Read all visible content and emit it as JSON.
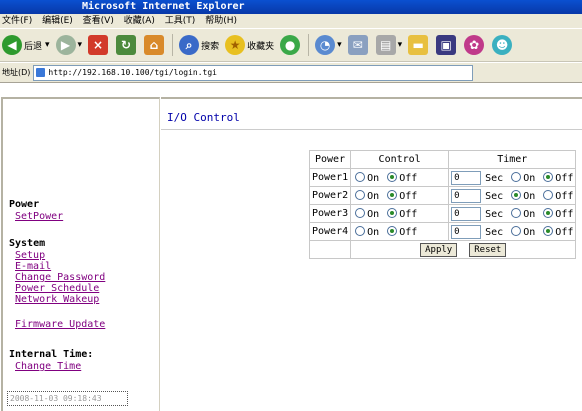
{
  "window": {
    "title": "Microsoft Internet Explorer"
  },
  "menu": [
    "文件(F)",
    "编辑(E)",
    "查看(V)",
    "收藏(A)",
    "工具(T)",
    "帮助(H)"
  ],
  "toolbar": {
    "back_label": "后退",
    "search_label": "搜索",
    "favorites_label": "收藏夹"
  },
  "address": {
    "label": "地址(D)",
    "url": "http://192.168.10.100/tgi/login.tgi"
  },
  "sidebar": {
    "power_heading": "Power",
    "set_power": "SetPower",
    "system_heading": "System",
    "setup": "Setup",
    "email": "E-mail",
    "change_password": "Change Password",
    "power_schedule": "Power Schedule",
    "network_wakeup": "Network Wakeup",
    "firmware_update": "Firmware Update",
    "internal_time_heading": "Internal Time:",
    "change_time": "Change Time",
    "current_time": "2008-11-03 09:18:43"
  },
  "main": {
    "title": "I/O Control",
    "headers": {
      "power": "Power",
      "control": "Control",
      "timer": "Timer"
    },
    "on_label": "On",
    "off_label": "Off",
    "sec_label": "Sec",
    "rows": [
      {
        "name": "Power1",
        "control": "off",
        "timer": "0",
        "timer_state": "off"
      },
      {
        "name": "Power2",
        "control": "off",
        "timer": "0",
        "timer_state": "on"
      },
      {
        "name": "Power3",
        "control": "off",
        "timer": "0",
        "timer_state": "off"
      },
      {
        "name": "Power4",
        "control": "off",
        "timer": "0",
        "timer_state": "off"
      }
    ],
    "apply_label": "Apply",
    "reset_label": "Reset"
  }
}
